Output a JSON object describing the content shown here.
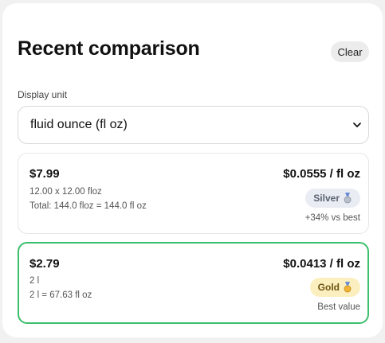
{
  "header": {
    "title": "Recent comparison",
    "clear_label": "Clear"
  },
  "unit": {
    "label": "Display unit",
    "selected": "fluid ounce (fl oz)"
  },
  "items": [
    {
      "price": "$7.99",
      "detail_line1": "12.00 x 12.00 floz",
      "detail_line2": "Total: 144.0 floz = 144.0 fl oz",
      "unit_price": "$0.0555 / fl oz",
      "badge": "Silver",
      "badge_icon": "silver-medal-icon",
      "note": "+34% vs best"
    },
    {
      "price": "$2.79",
      "detail_line1": "2 l",
      "detail_line2": "2 l = 67.63 fl oz",
      "unit_price": "$0.0413 / fl oz",
      "badge": "Gold",
      "badge_icon": "gold-medal-icon",
      "note": "Best value"
    }
  ],
  "colors": {
    "best_border": "#3cbf6c",
    "gold_badge": "#fbefc0",
    "silver_badge": "#e9ecf2"
  }
}
